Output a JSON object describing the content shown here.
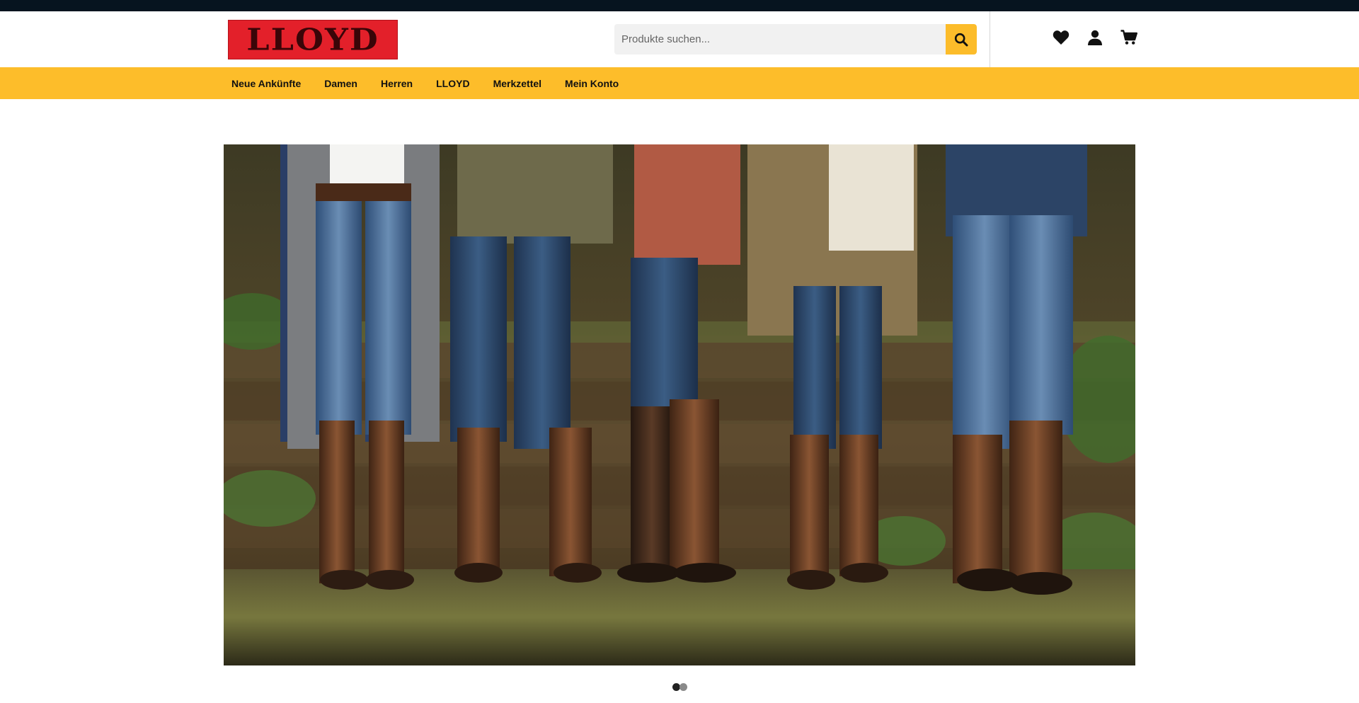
{
  "brand": {
    "name": "LLOYD",
    "logo_color": "#e3202a"
  },
  "search": {
    "placeholder": "Produkte suchen...",
    "button_icon": "search-icon",
    "accent": "#fcbc2a"
  },
  "header_icons": [
    {
      "name": "heart-icon",
      "label": "Wunschliste"
    },
    {
      "name": "user-icon",
      "label": "Konto"
    },
    {
      "name": "cart-icon",
      "label": "Warenkorb"
    }
  ],
  "nav": {
    "items": [
      {
        "label": "Neue Ankünfte"
      },
      {
        "label": "Damen"
      },
      {
        "label": "Herren"
      },
      {
        "label": "LLOYD"
      },
      {
        "label": "Merkzettel"
      },
      {
        "label": "Mein Konto"
      }
    ],
    "background": "#fdbd2a"
  },
  "slider": {
    "slide_count": 2,
    "active_slide": 1
  }
}
